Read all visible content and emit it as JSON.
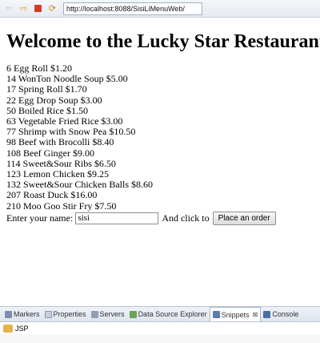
{
  "browser": {
    "url": "http://localhost:8088/SisiLiMenuWeb/"
  },
  "page": {
    "title": "Welcome to the Lucky Star Restaurant",
    "menu": [
      "6 Egg Roll $1.20",
      "14 WonTon Noodle Soup $5.00",
      "17 Spring Roll $1.70",
      "22 Egg Drop Soup $3.00",
      "50 Boiled Rice $1.50",
      "63 Vegetable Fried Rice $3.00",
      "77 Shrimp with Snow Pea $10.50",
      "98 Beef with Brocolli $8.40",
      "108 Beef Ginger $9.00",
      "114 Sweet&Sour Ribs $6.50",
      "123 Lemon Chicken $9.25",
      "132 Sweet&Sour Chicken Balls $8.60",
      "207 Roast Duck $16.00",
      "210 Moo Goo Stir Fry $7.50"
    ],
    "order": {
      "name_label": "Enter your name:",
      "name_value": "sisi",
      "click_label": "And click to",
      "button_label": "Place an order"
    }
  },
  "views": {
    "tabs": [
      {
        "label": "Markers",
        "icon": "markers-icon",
        "active": false
      },
      {
        "label": "Properties",
        "icon": "properties-icon",
        "active": false
      },
      {
        "label": "Servers",
        "icon": "servers-icon",
        "active": false
      },
      {
        "label": "Data Source Explorer",
        "icon": "data-source-icon",
        "active": false
      },
      {
        "label": "Snippets",
        "icon": "snippets-icon",
        "active": true
      },
      {
        "label": "Console",
        "icon": "console-icon",
        "active": false
      }
    ],
    "snippet_category": "JSP"
  }
}
